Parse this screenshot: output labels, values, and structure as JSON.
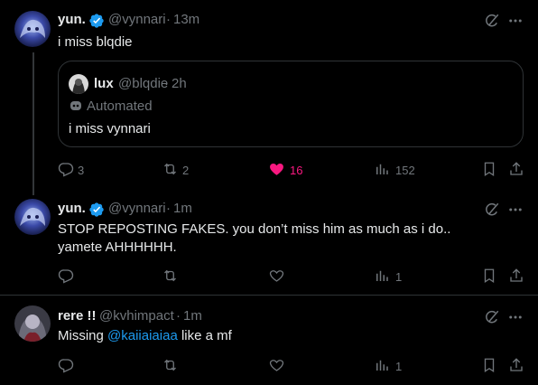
{
  "tweets": [
    {
      "display_name": "yun.",
      "handle": "@vynnari",
      "time": "13m",
      "text": "i miss blqdie",
      "quote": {
        "display_name": "lux",
        "handle": "@blqdie",
        "time": "2h",
        "label": "Automated",
        "text": "i miss vynnari"
      },
      "replies": "3",
      "reposts": "2",
      "likes": "16",
      "views": "152"
    },
    {
      "display_name": "yun.",
      "handle": "@vynnari",
      "time": "1m",
      "text": "STOP REPOSTING FAKES. you don’t miss him as much as i do.. yamete AHHHHHH.",
      "views": "1"
    },
    {
      "display_name": "rere !!",
      "handle": "@kvhimpact",
      "time": "1m",
      "text_before": "Missing ",
      "mention": "@kaiiaiaiaa",
      "text_after": " like a mf",
      "views": "1"
    }
  ],
  "colors": {
    "background": "#000000",
    "text": "#e7e9ea",
    "secondary": "#71767b",
    "verified": "#1d9bf0",
    "like": "#f91880",
    "link": "#1d9bf0"
  },
  "icons": [
    "verified-badge-icon",
    "grok-icon",
    "more-icon",
    "reply-icon",
    "repost-icon",
    "like-icon",
    "views-icon",
    "bookmark-icon",
    "share-icon",
    "automated-bot-icon"
  ]
}
